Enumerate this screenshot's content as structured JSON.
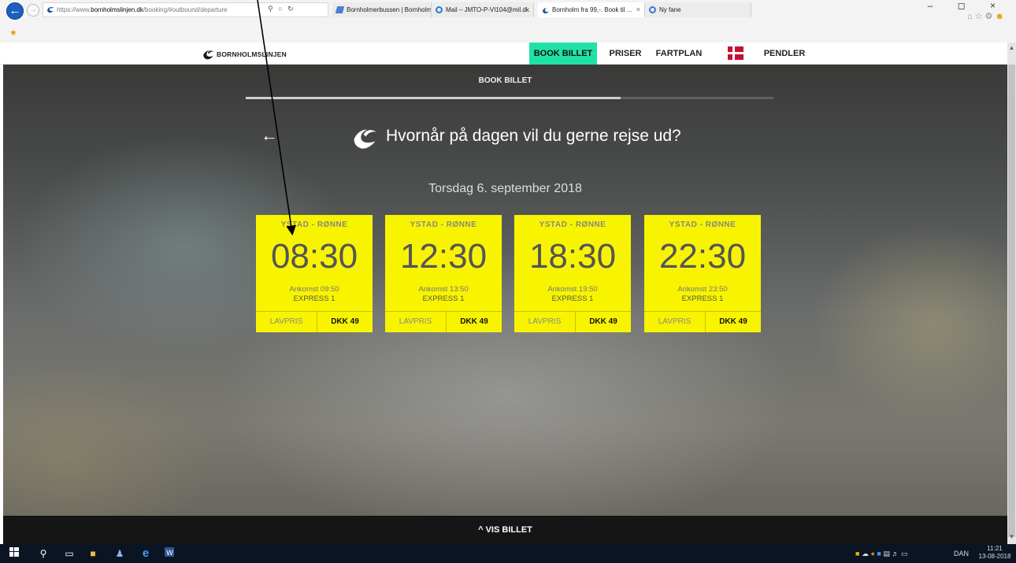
{
  "browser": {
    "url_prefix": "https://www.",
    "url_host": "bornholmslinjen.dk",
    "url_path": "/booking/#outbound/departure",
    "tabs": [
      {
        "label": "Bornholmerbussen | Bornholm..."
      },
      {
        "label": "Mail – JMTO-P-VI104@mil.dk"
      },
      {
        "label": "Bornholm fra 99,-. Book til ...",
        "close": "×"
      },
      {
        "label": "Ny fane"
      }
    ],
    "window_controls": "– ◻ ×"
  },
  "site": {
    "logo_text": "BORNHOLMSLINJEN",
    "nav": [
      {
        "label": "BOOK BILLET",
        "active": true
      },
      {
        "label": "PRISER"
      },
      {
        "label": "FARTPLAN"
      },
      {
        "label": "PENDLER"
      }
    ],
    "accent_color": "#20e2a6"
  },
  "booking": {
    "section_label": "BOOK BILLET",
    "progress_fraction": 0.71,
    "question": "Hvornår på dagen vil du gerne rejse ud?",
    "date": "Torsdag 6. september 2018",
    "card_color": "#f8f400",
    "departures": [
      {
        "route": "YSTAD - RØNNE",
        "time": "08:30",
        "arrival": "Ankomst 09:50",
        "ship": "EXPRESS 1",
        "fare": "LAVPRIS",
        "price": "DKK 49"
      },
      {
        "route": "YSTAD - RØNNE",
        "time": "12:30",
        "arrival": "Ankomst 13:50",
        "ship": "EXPRESS 1",
        "fare": "LAVPRIS",
        "price": "DKK 49"
      },
      {
        "route": "YSTAD - RØNNE",
        "time": "18:30",
        "arrival": "Ankomst 19:50",
        "ship": "EXPRESS 1",
        "fare": "LAVPRIS",
        "price": "DKK 49"
      },
      {
        "route": "YSTAD - RØNNE",
        "time": "22:30",
        "arrival": "Ankomst 23:50",
        "ship": "EXPRESS 1",
        "fare": "LAVPRIS",
        "price": "DKK 49"
      }
    ]
  },
  "footer": {
    "vis_billet": "^ VIS BILLET"
  },
  "taskbar": {
    "language": "DAN",
    "time": "11:21",
    "date": "13-08-2018"
  }
}
